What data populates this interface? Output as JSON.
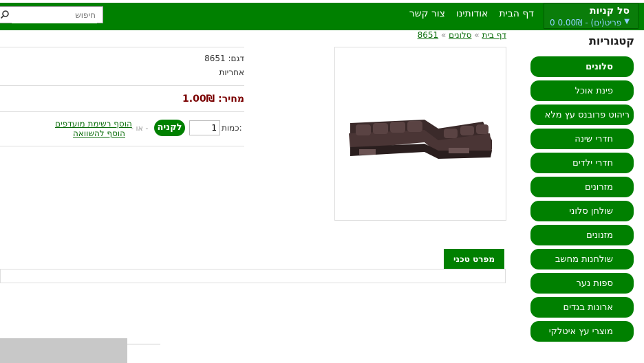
{
  "cart": {
    "title": "סל קניות",
    "summary": "0 פריט(ים) - 0.00₪"
  },
  "nav": [
    "דף הבית",
    "אודותינו",
    "צור קשר"
  ],
  "search": {
    "placeholder": "חיפוש"
  },
  "categories": {
    "title": "קטגוריות",
    "items": [
      "סלונים",
      "פינת אוכל",
      "ריהוט פרובנס עץ מלא",
      "חדרי שינה",
      "חדרי ילדים",
      "מזרונים",
      "שולחן סלוני",
      "מזנונים",
      "שולחנות מחשב",
      "ספות נער",
      "ארונות בגדים",
      "מוצרי עץ איטלקי"
    ]
  },
  "breadcrumb": [
    "דף בית",
    "סלונים",
    "8651"
  ],
  "product": {
    "model_label": "דגם:",
    "model": "8651",
    "warranty": "אחריות",
    "price_label": "מחיר:",
    "price": "1.00₪",
    "qty_label": "כמות:",
    "qty": "1",
    "buy_label": "לקניה",
    "or_label": "- או -",
    "wishlist_label": "הוסף רשימת מועדפים",
    "compare_label": "הוסף להשוואה"
  },
  "tabs": {
    "specs": "מפרט טכני"
  },
  "colors": {
    "accent": "#008000",
    "price": "#7a0000",
    "link": "#0a6d0a"
  }
}
